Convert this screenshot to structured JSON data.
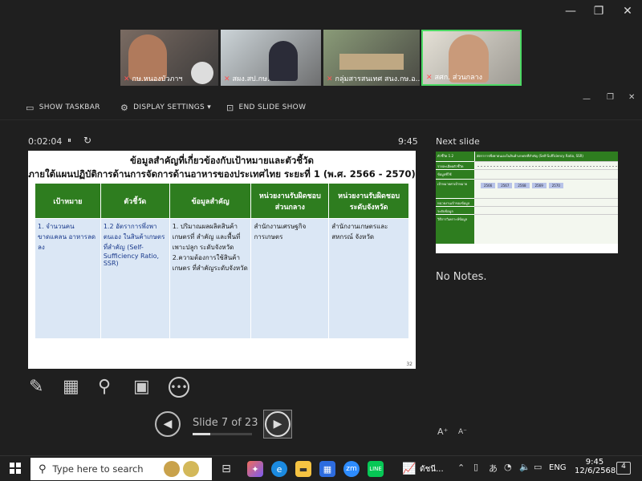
{
  "window": {
    "minimize": "—",
    "restore": "❐",
    "close": "✕"
  },
  "video": {
    "tiles": [
      {
        "label": "กษ.หนองบัวภาฯ"
      },
      {
        "label": "สผง.สป.กษ."
      },
      {
        "label": "กลุ่มสารสนเทศ สนง.กษ.อ..."
      },
      {
        "label": "สศก. ส่วนกลาง"
      }
    ]
  },
  "toolbar": {
    "show_taskbar": "SHOW TASKBAR",
    "display_settings": "DISPLAY SETTINGS ▾",
    "end_slide_show": "END SLIDE SHOW"
  },
  "presenter": {
    "timer": "0:02:04",
    "pause": "⏸",
    "reset": "↻",
    "clock": "9:45",
    "next_slide_label": "Next slide",
    "notes": "No Notes.",
    "slide_counter": "Slide 7 of 23",
    "progress": 0.3
  },
  "slide": {
    "title_line1": "ข้อมูลสำคัญที่เกี่ยวข้องกับเป้าหมายและตัวชี้วัด",
    "title_line2": "ภายใต้แผนปฏิบัติการด้านการจัดการด้านอาหารของประเทศไทย ระยะที่ 1 (พ.ศ. 2566 - 2570)",
    "headers": [
      "เป้าหมาย",
      "ตัวชี้วัด",
      "ข้อมูลสำคัญ",
      "หน่วยงานรับผิดชอบ ส่วนกลาง",
      "หน่วยงานรับผิดชอบ ระดับจังหวัด"
    ],
    "cells": [
      "1. จำนวนคนขาดแคลน อาหารลดลง",
      "1.2 อัตราการพึ่งพาตนเอง ในสินค้าเกษตรที่สำคัญ (Self-Sufficiency Ratio, SSR)",
      "1. ปริมาณผลผลิตสินค้าเกษตรที่ สำคัญ และพื้นที่เพาะปลูก ระดับจังหวัด 2.ความต้องการใช้สินค้าเกษตร ที่สำคัญระดับจังหวัด",
      "สำนักงานเศรษฐกิจการเกษตร",
      "สำนักงานเกษตรและสหกรณ์ จังหวัด"
    ],
    "page_number": "32"
  },
  "thumb": {
    "row1_label": "ตัวชี้วัด 1.2",
    "row1_title": "อัตราการพึ่งพาตนเองในสินค้าเกษตรที่สำคัญ (Self-Sufficiency Ratio, SSR)",
    "rows": [
      "รายละเอียดตัวชี้วัด",
      "ข้อมูลที่ใช้",
      "เป้าหมายค่าเป้าหมาย",
      "หน่วยงานเจ้าของข้อมูล",
      "ระดับข้อมูล",
      "วิธีการวิเคราะห์ข้อมูล"
    ],
    "years": [
      "2566",
      "2567",
      "2568",
      "2569",
      "2570"
    ]
  },
  "text_size": {
    "larger": "A⁺",
    "smaller": "A⁻"
  },
  "taskbar": {
    "search_placeholder": "Type here to search",
    "tray_app_label": "ดัชนี...",
    "lang": "ENG",
    "time": "9:45",
    "date": "12/6/2568",
    "notif_count": "4"
  }
}
